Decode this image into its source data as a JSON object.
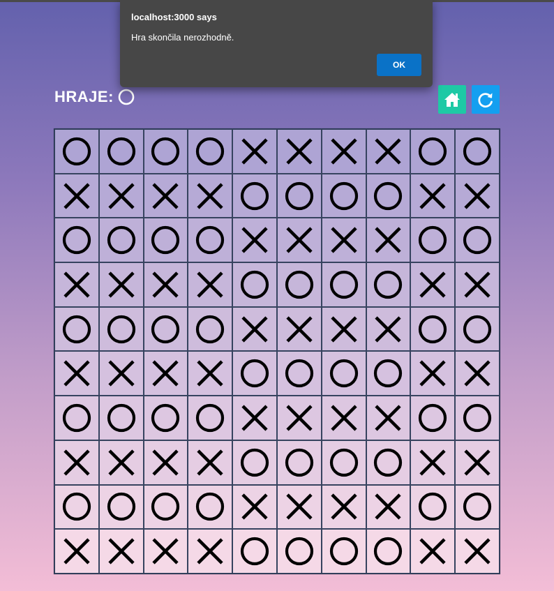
{
  "status": {
    "label": "HRAJE:",
    "current_player": "O"
  },
  "toolbar": {
    "home_icon": "home-icon",
    "restart_icon": "restart-icon",
    "home_color": "#1ec9a5",
    "restart_color": "#149ff0"
  },
  "dialog": {
    "title": "localhost:3000 says",
    "message": "Hra skončila nerozhodně.",
    "ok_label": "OK"
  },
  "board": {
    "size": 10,
    "rows": [
      [
        "O",
        "O",
        "O",
        "O",
        "X",
        "X",
        "X",
        "X",
        "O",
        "O"
      ],
      [
        "X",
        "X",
        "X",
        "X",
        "O",
        "O",
        "O",
        "O",
        "X",
        "X"
      ],
      [
        "O",
        "O",
        "O",
        "O",
        "X",
        "X",
        "X",
        "X",
        "O",
        "O"
      ],
      [
        "X",
        "X",
        "X",
        "X",
        "O",
        "O",
        "O",
        "O",
        "X",
        "X"
      ],
      [
        "O",
        "O",
        "O",
        "O",
        "X",
        "X",
        "X",
        "X",
        "O",
        "O"
      ],
      [
        "X",
        "X",
        "X",
        "X",
        "O",
        "O",
        "O",
        "O",
        "X",
        "X"
      ],
      [
        "O",
        "O",
        "O",
        "O",
        "X",
        "X",
        "X",
        "X",
        "O",
        "O"
      ],
      [
        "X",
        "X",
        "X",
        "X",
        "O",
        "O",
        "O",
        "O",
        "X",
        "X"
      ],
      [
        "O",
        "O",
        "O",
        "O",
        "X",
        "X",
        "X",
        "X",
        "O",
        "O"
      ],
      [
        "X",
        "X",
        "X",
        "X",
        "O",
        "O",
        "O",
        "O",
        "X",
        "X"
      ]
    ]
  },
  "colors": {
    "board_top": "#aea4d4",
    "board_bottom": "#f5d9e7",
    "grid_line": "#36435f",
    "ok_button": "#0a72c7"
  }
}
